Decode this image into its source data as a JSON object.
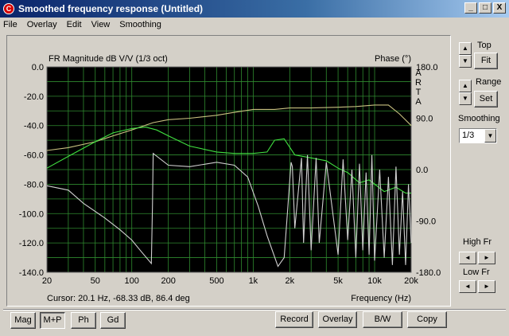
{
  "window": {
    "title": "Smoothed frequency response (Untitled)",
    "controls": [
      "_",
      "□",
      "X"
    ]
  },
  "menu": [
    {
      "label": "File"
    },
    {
      "label": "Overlay"
    },
    {
      "label": "Edit"
    },
    {
      "label": "View"
    },
    {
      "label": "Smoothing"
    }
  ],
  "chart_data": {
    "type": "line",
    "title": "FR Magnitude dB V/V (1/3 oct)",
    "right_title": "Phase (°)",
    "brand": [
      "A",
      "R",
      "T",
      "A"
    ],
    "xlabel": "Frequency (Hz)",
    "xscale": "log",
    "xlim": [
      20,
      20000
    ],
    "xticks": [
      20,
      50,
      100,
      200,
      500,
      1000,
      2000,
      5000,
      10000,
      20000
    ],
    "xtick_labels": [
      "20",
      "50",
      "100",
      "200",
      "500",
      "1k",
      "2k",
      "5k",
      "10k",
      "20k"
    ],
    "ylim": [
      -140,
      0
    ],
    "yticks": [
      0,
      -20,
      -40,
      -60,
      -80,
      -100,
      -120,
      -140
    ],
    "ytick_labels": [
      "0.0",
      "-20.0",
      "-40.0",
      "-60.0",
      "-80.0",
      "-100.0",
      "-120.0",
      "-140.0"
    ],
    "y2lim": [
      -180,
      180
    ],
    "y2ticks": [
      180,
      90,
      0,
      -90,
      -180
    ],
    "y2tick_labels": [
      "180.0",
      "90.0",
      "0.0",
      "-90.0",
      "-180.0"
    ],
    "grid": true,
    "series": [
      {
        "color": "#c8c080",
        "x": [
          20,
          30,
          50,
          70,
          100,
          150,
          200,
          300,
          500,
          700,
          1000,
          1500,
          2000,
          3000,
          5000,
          7000,
          10000,
          13000,
          16000,
          20000
        ],
        "y": [
          -57,
          -55,
          -51,
          -47,
          -43,
          -38,
          -36,
          -35,
          -33,
          -31,
          -29,
          -29,
          -28,
          -28,
          -27.5,
          -27,
          -26,
          -26,
          -32,
          -40
        ]
      },
      {
        "color": "#40e040",
        "x": [
          20,
          30,
          50,
          70,
          100,
          130,
          160,
          200,
          300,
          500,
          700,
          1000,
          1300,
          1500,
          1800,
          2200,
          3000,
          4000,
          5000,
          6000,
          7500,
          9000,
          12000,
          15000,
          18000,
          20000
        ],
        "y": [
          -69,
          -61,
          -51,
          -45,
          -42,
          -41,
          -43,
          -47,
          -54,
          -58,
          -59,
          -59,
          -58,
          -50,
          -49,
          -60,
          -62,
          -64,
          -69,
          -72,
          -79,
          -77,
          -85,
          -82,
          -86,
          -86
        ]
      },
      {
        "color": "#d0d0d0",
        "x": [
          20,
          30,
          40,
          60,
          80,
          100,
          120,
          145,
          148,
          150,
          200,
          300,
          500,
          700,
          900,
          1100,
          1300,
          1600,
          1800,
          2050,
          2100,
          2200,
          2500,
          2600,
          2800,
          3000,
          3300,
          3500,
          4000,
          5000,
          5500,
          6000,
          6500,
          7000,
          7500,
          8000,
          8500,
          9000,
          9500,
          10000,
          11000,
          12000,
          13000,
          14000,
          15000,
          16000,
          17000,
          18000,
          19000,
          20000
        ],
        "y": [
          -81,
          -84,
          -93,
          -103,
          -111,
          -118,
          -126,
          -134,
          -95,
          -59,
          -67,
          -68,
          -65,
          -67,
          -75,
          -95,
          -115,
          -136,
          -130,
          -65,
          -68,
          -110,
          -62,
          -120,
          -60,
          -125,
          -62,
          -120,
          -65,
          -128,
          -63,
          -118,
          -70,
          -130,
          -66,
          -125,
          -72,
          -128,
          -60,
          -132,
          -70,
          -130,
          -75,
          -135,
          -68,
          -128,
          -85,
          -135,
          -80,
          -120
        ]
      }
    ]
  },
  "readout": {
    "cursor": "Cursor: 20.1 Hz, -68.33 dB, 86.4 deg"
  },
  "side": {
    "top_label": "Top",
    "fit_label": "Fit",
    "range_label": "Range",
    "set_label": "Set",
    "smoothing_label": "Smoothing",
    "smoothing_value": "1/3",
    "highfr_label": "High Fr",
    "lowfr_label": "Low Fr"
  },
  "bottom_buttons": {
    "mag": "Mag",
    "mp": "M+P",
    "ph": "Ph",
    "gd": "Gd",
    "record": "Record",
    "overlay": "Overlay",
    "bw": "B/W",
    "copy": "Copy"
  }
}
